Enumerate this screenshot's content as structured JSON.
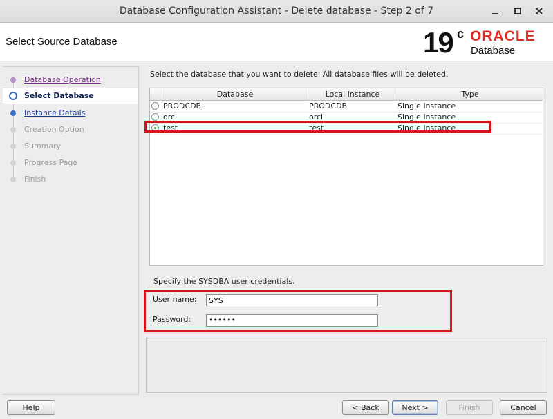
{
  "window": {
    "title": "Database Configuration Assistant - Delete database - Step 2 of 7"
  },
  "header": {
    "page_title": "Select Source Database",
    "logo_version": "19",
    "logo_superscript": "c",
    "logo_brand": "ORACLE",
    "logo_product": "Database"
  },
  "nav": {
    "items": [
      {
        "label": "Database Operation",
        "state": "done"
      },
      {
        "label": "Select Database",
        "state": "active"
      },
      {
        "label": "Instance Details",
        "state": "link"
      },
      {
        "label": "Creation Option",
        "state": "pending"
      },
      {
        "label": "Summary",
        "state": "pending"
      },
      {
        "label": "Progress Page",
        "state": "pending"
      },
      {
        "label": "Finish",
        "state": "pending"
      }
    ]
  },
  "main": {
    "instruction": "Select the database that you want to delete. All database files will be deleted.",
    "table": {
      "columns": [
        "Database",
        "Local instance",
        "Type"
      ],
      "rows": [
        {
          "database": "PRODCDB",
          "instance": "PRODCDB",
          "type": "Single Instance",
          "selected": false
        },
        {
          "database": "orcl",
          "instance": "orcl",
          "type": "Single Instance",
          "selected": false
        },
        {
          "database": "test",
          "instance": "test",
          "type": "Single Instance",
          "selected": true
        }
      ]
    },
    "credentials": {
      "label": "Specify the SYSDBA user credentials.",
      "username_label": "User name:",
      "username_value": "SYS",
      "password_label": "Password:",
      "password_value": "••••••"
    }
  },
  "buttons": {
    "help": "Help",
    "back": "< Back",
    "next": "Next >",
    "finish": "Finish",
    "cancel": "Cancel"
  },
  "colors": {
    "highlight": "#d8141b",
    "brand_red": "#e32a1c",
    "link_blue": "#1a3fa0",
    "visited_purple": "#7a2a8c"
  }
}
